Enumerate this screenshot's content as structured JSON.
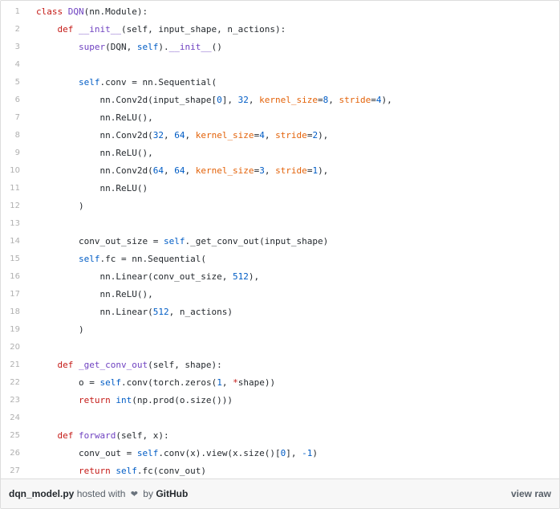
{
  "code_lines": [
    {
      "n": "1",
      "segs": [
        {
          "t": "class ",
          "c": "kw"
        },
        {
          "t": "DQN",
          "c": "fn"
        },
        {
          "t": "(nn.Module):",
          "c": ""
        }
      ]
    },
    {
      "n": "2",
      "segs": [
        {
          "t": "    def ",
          "c": "kw"
        },
        {
          "t": "__init__",
          "c": "fn"
        },
        {
          "t": "(self, input_shape, n_actions):",
          "c": ""
        }
      ]
    },
    {
      "n": "3",
      "segs": [
        {
          "t": "        ",
          "c": ""
        },
        {
          "t": "super",
          "c": "fn"
        },
        {
          "t": "(DQN, ",
          "c": ""
        },
        {
          "t": "self",
          "c": "bi"
        },
        {
          "t": ").",
          "c": ""
        },
        {
          "t": "__init__",
          "c": "fn"
        },
        {
          "t": "()",
          "c": ""
        }
      ]
    },
    {
      "n": "4",
      "segs": []
    },
    {
      "n": "5",
      "segs": [
        {
          "t": "        ",
          "c": ""
        },
        {
          "t": "self",
          "c": "bi"
        },
        {
          "t": ".conv = nn.Sequential(",
          "c": ""
        }
      ]
    },
    {
      "n": "6",
      "segs": [
        {
          "t": "            nn.Conv2d(input_shape[",
          "c": ""
        },
        {
          "t": "0",
          "c": "num"
        },
        {
          "t": "], ",
          "c": ""
        },
        {
          "t": "32",
          "c": "num"
        },
        {
          "t": ", ",
          "c": ""
        },
        {
          "t": "kernel_size",
          "c": "kwa"
        },
        {
          "t": "=",
          "c": ""
        },
        {
          "t": "8",
          "c": "num"
        },
        {
          "t": ", ",
          "c": ""
        },
        {
          "t": "stride",
          "c": "kwa"
        },
        {
          "t": "=",
          "c": ""
        },
        {
          "t": "4",
          "c": "num"
        },
        {
          "t": "),",
          "c": ""
        }
      ]
    },
    {
      "n": "7",
      "segs": [
        {
          "t": "            nn.ReLU(),",
          "c": ""
        }
      ]
    },
    {
      "n": "8",
      "segs": [
        {
          "t": "            nn.Conv2d(",
          "c": ""
        },
        {
          "t": "32",
          "c": "num"
        },
        {
          "t": ", ",
          "c": ""
        },
        {
          "t": "64",
          "c": "num"
        },
        {
          "t": ", ",
          "c": ""
        },
        {
          "t": "kernel_size",
          "c": "kwa"
        },
        {
          "t": "=",
          "c": ""
        },
        {
          "t": "4",
          "c": "num"
        },
        {
          "t": ", ",
          "c": ""
        },
        {
          "t": "stride",
          "c": "kwa"
        },
        {
          "t": "=",
          "c": ""
        },
        {
          "t": "2",
          "c": "num"
        },
        {
          "t": "),",
          "c": ""
        }
      ]
    },
    {
      "n": "9",
      "segs": [
        {
          "t": "            nn.ReLU(),",
          "c": ""
        }
      ]
    },
    {
      "n": "10",
      "segs": [
        {
          "t": "            nn.Conv2d(",
          "c": ""
        },
        {
          "t": "64",
          "c": "num"
        },
        {
          "t": ", ",
          "c": ""
        },
        {
          "t": "64",
          "c": "num"
        },
        {
          "t": ", ",
          "c": ""
        },
        {
          "t": "kernel_size",
          "c": "kwa"
        },
        {
          "t": "=",
          "c": ""
        },
        {
          "t": "3",
          "c": "num"
        },
        {
          "t": ", ",
          "c": ""
        },
        {
          "t": "stride",
          "c": "kwa"
        },
        {
          "t": "=",
          "c": ""
        },
        {
          "t": "1",
          "c": "num"
        },
        {
          "t": "),",
          "c": ""
        }
      ]
    },
    {
      "n": "11",
      "segs": [
        {
          "t": "            nn.ReLU()",
          "c": ""
        }
      ]
    },
    {
      "n": "12",
      "segs": [
        {
          "t": "        )",
          "c": ""
        }
      ]
    },
    {
      "n": "13",
      "segs": []
    },
    {
      "n": "14",
      "segs": [
        {
          "t": "        conv_out_size = ",
          "c": ""
        },
        {
          "t": "self",
          "c": "bi"
        },
        {
          "t": "._get_conv_out(input_shape)",
          "c": ""
        }
      ]
    },
    {
      "n": "15",
      "segs": [
        {
          "t": "        ",
          "c": ""
        },
        {
          "t": "self",
          "c": "bi"
        },
        {
          "t": ".fc = nn.Sequential(",
          "c": ""
        }
      ]
    },
    {
      "n": "16",
      "segs": [
        {
          "t": "            nn.Linear(conv_out_size, ",
          "c": ""
        },
        {
          "t": "512",
          "c": "num"
        },
        {
          "t": "),",
          "c": ""
        }
      ]
    },
    {
      "n": "17",
      "segs": [
        {
          "t": "            nn.ReLU(),",
          "c": ""
        }
      ]
    },
    {
      "n": "18",
      "segs": [
        {
          "t": "            nn.Linear(",
          "c": ""
        },
        {
          "t": "512",
          "c": "num"
        },
        {
          "t": ", n_actions)",
          "c": ""
        }
      ]
    },
    {
      "n": "19",
      "segs": [
        {
          "t": "        )",
          "c": ""
        }
      ]
    },
    {
      "n": "20",
      "segs": []
    },
    {
      "n": "21",
      "segs": [
        {
          "t": "    def ",
          "c": "kw"
        },
        {
          "t": "_get_conv_out",
          "c": "fn"
        },
        {
          "t": "(self, shape):",
          "c": ""
        }
      ]
    },
    {
      "n": "22",
      "segs": [
        {
          "t": "        o = ",
          "c": ""
        },
        {
          "t": "self",
          "c": "bi"
        },
        {
          "t": ".conv(torch.zeros(",
          "c": ""
        },
        {
          "t": "1",
          "c": "num"
        },
        {
          "t": ", ",
          "c": ""
        },
        {
          "t": "*",
          "c": "kw"
        },
        {
          "t": "shape))",
          "c": ""
        }
      ]
    },
    {
      "n": "23",
      "segs": [
        {
          "t": "        ",
          "c": ""
        },
        {
          "t": "return ",
          "c": "kw"
        },
        {
          "t": "int",
          "c": "bi"
        },
        {
          "t": "(np.prod(o.size()))",
          "c": ""
        }
      ]
    },
    {
      "n": "24",
      "segs": []
    },
    {
      "n": "25",
      "segs": [
        {
          "t": "    def ",
          "c": "kw"
        },
        {
          "t": "forward",
          "c": "fn"
        },
        {
          "t": "(self, x):",
          "c": ""
        }
      ]
    },
    {
      "n": "26",
      "segs": [
        {
          "t": "        conv_out = ",
          "c": ""
        },
        {
          "t": "self",
          "c": "bi"
        },
        {
          "t": ".conv(x).view(x.size()[",
          "c": ""
        },
        {
          "t": "0",
          "c": "num"
        },
        {
          "t": "], ",
          "c": ""
        },
        {
          "t": "-1",
          "c": "num"
        },
        {
          "t": ")",
          "c": ""
        }
      ]
    },
    {
      "n": "27",
      "segs": [
        {
          "t": "        ",
          "c": ""
        },
        {
          "t": "return ",
          "c": "kw"
        },
        {
          "t": "self",
          "c": "bi"
        },
        {
          "t": ".fc(conv_out)",
          "c": ""
        }
      ]
    }
  ],
  "footer": {
    "filename": "dqn_model.py",
    "hosted_with": "hosted with",
    "heart_icon": "heart-icon",
    "by": "by",
    "github": "GitHub",
    "view_raw": "view raw"
  }
}
